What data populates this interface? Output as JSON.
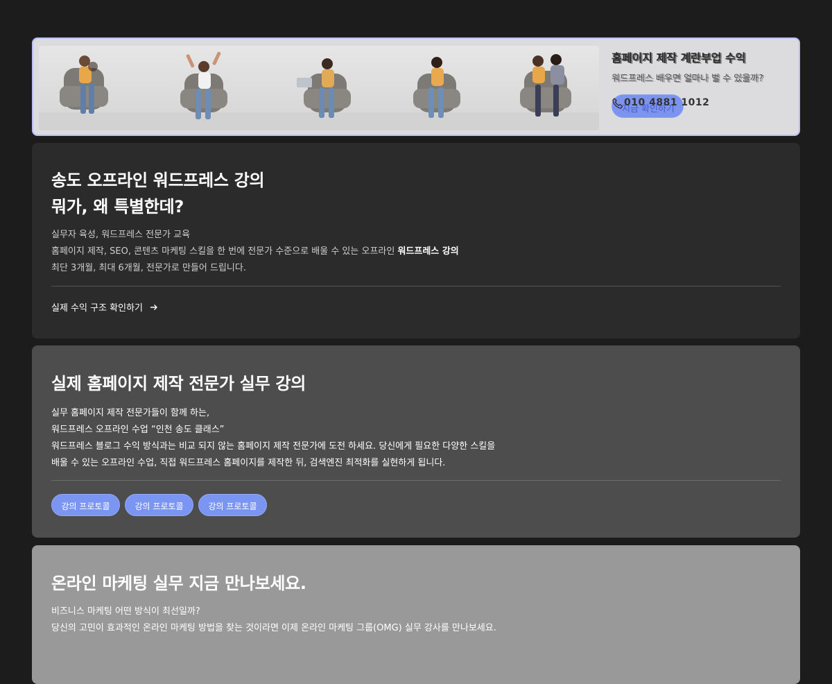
{
  "hero": {
    "title": "홈페이지 제작 계란부업 수익",
    "title_overlay": "홈페이지 제작 계란부업 수익",
    "subtitle": "워드프레스 배우면 얼마나 벌 수 있을까?",
    "subtitle_overlay": "워드프레스 배우면 얼마나 벌 수 있을까?",
    "button_label": "지금 확인하기",
    "phone_icon": "phone-icon",
    "phone": "010 4881 1012"
  },
  "card1": {
    "title_line1": "송도 오프라인 워드프레스 강의",
    "title_line2": "뭐가, 왜 특별한데?",
    "desc_line1": "실무자 육성, 워드프레스 전문가 교육",
    "desc_line2a": "홈페이지 제작, SEO, 콘텐츠 마케팅 스킬을 한 번에 전문가 수준으로 배울 수 있는 오프라인 ",
    "desc_line2b": "워드프레스 강의",
    "desc_line3": "최단 3개월, 최대 6개월, 전문가로 만들어 드립니다.",
    "link_label": "실제 수익 구조 확인하기",
    "link_icon": "arrow-right-icon"
  },
  "card2": {
    "title": "실제 홈페이지 제작 전문가 실무 강의",
    "lines": [
      "실무 홈페이지 제작 전문가들이 함께 하는,",
      "워드프레스 오프라인 수업 “인천 송도 클래스”",
      "워드프레스 블로그 수익 방식과는 비교 되지 않는 홈페이지 제작 전문가에 도전 하세요. 당신에게 필요한 다양한 스킬을",
      "배울 수 있는 오프라인 수업, 직접 워드프레스 홈페이지를 제작한 뒤, 검색엔진 최적화를 실현하게 됩니다."
    ],
    "pills": [
      "강의 프로토콜",
      "강의 프로토콜",
      "강의 프로토콜"
    ]
  },
  "card3": {
    "title": "온라인 마케팅 실무 지금 만나보세요.",
    "lines": [
      "비즈니스 마케팅 어떤 방식이 최선일까?",
      "당신의 고민이 효과적인 온라인 마케팅 방법을 찾는 것이라면 이제 온라인 마케팅 그룹(OMG) 실무 강사를 만나보세요."
    ]
  },
  "colors": {
    "page_bg": "#1c1c1c",
    "card1_bg": "#2b2b2b",
    "card2_bg": "#4d4d4d",
    "card3_bg": "#999999",
    "accent": "#7a96f2"
  }
}
